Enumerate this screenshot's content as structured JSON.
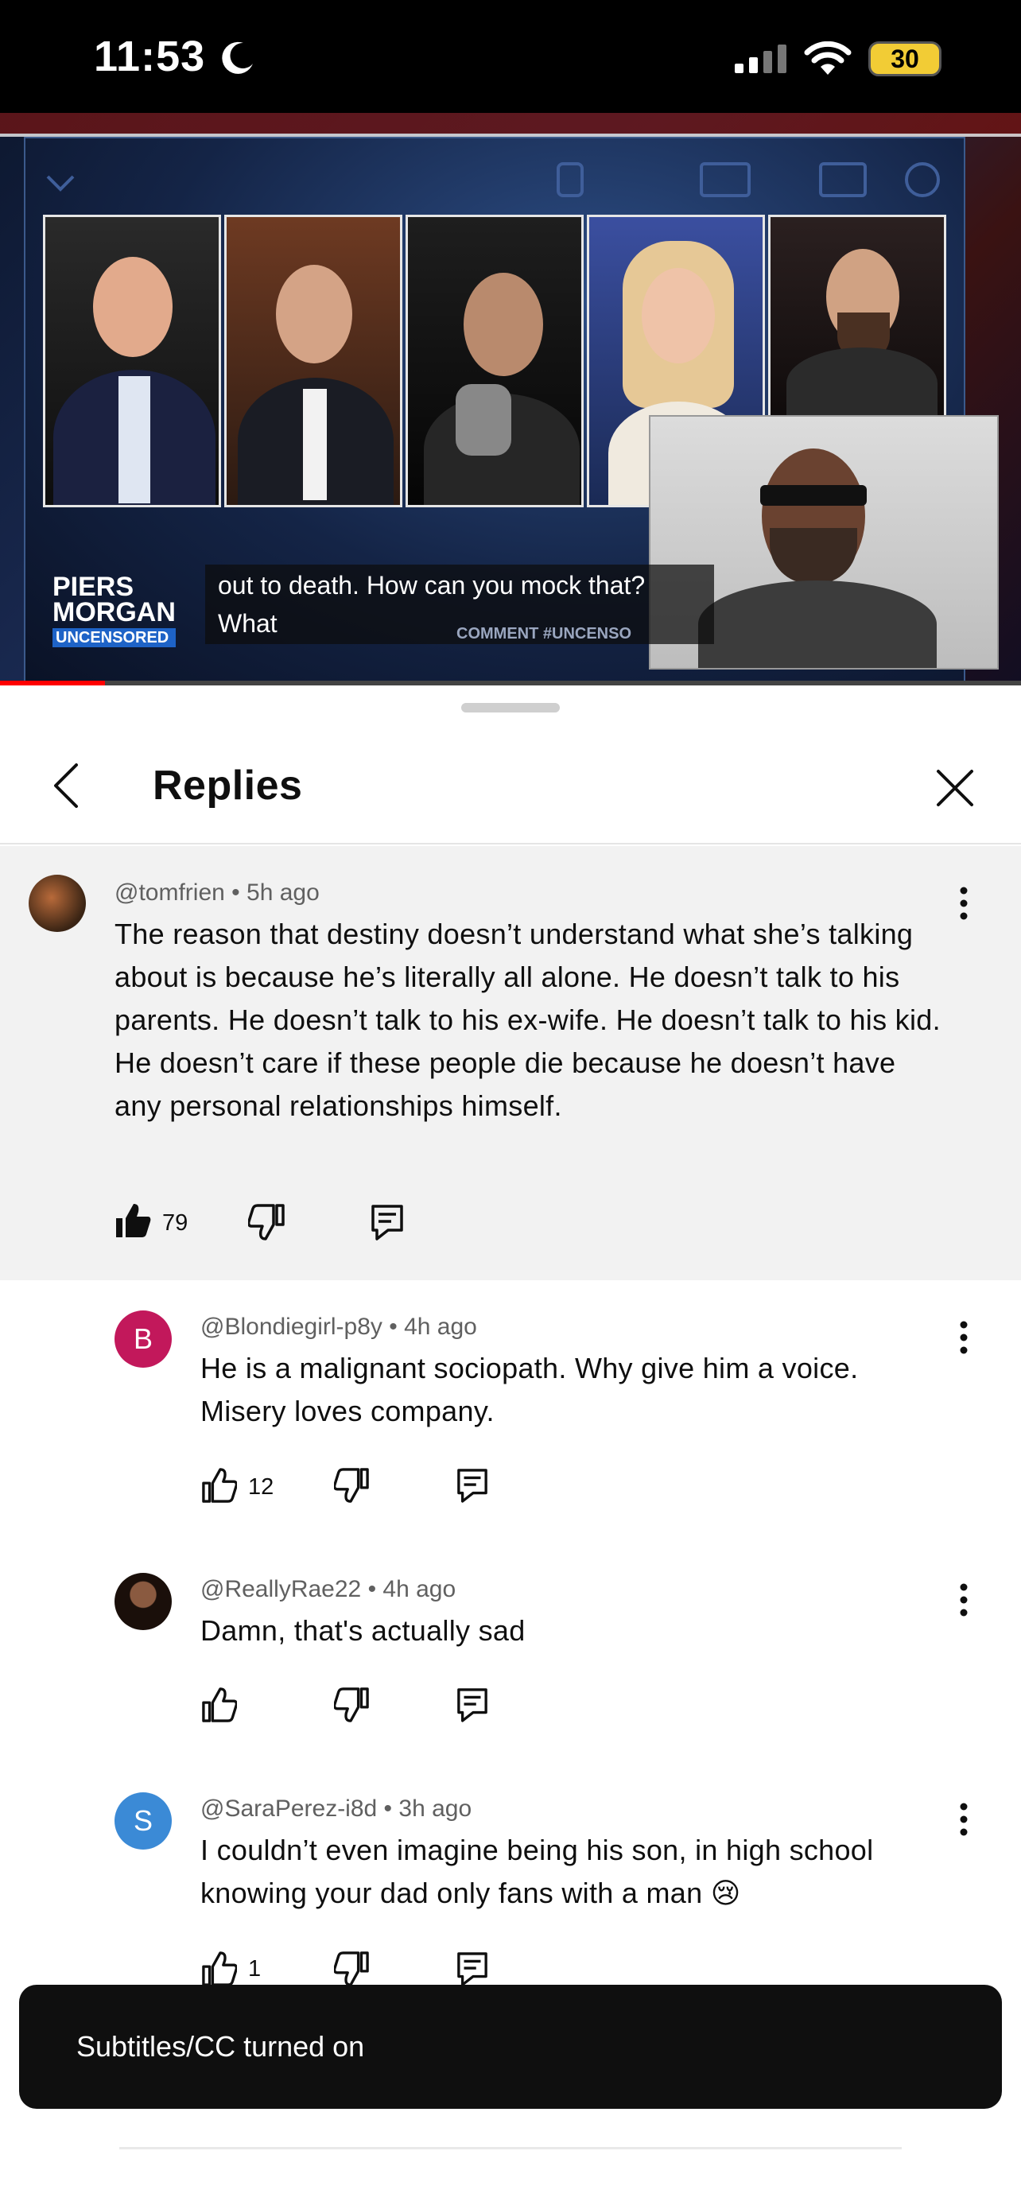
{
  "status_bar": {
    "time": "11:53",
    "battery": "30"
  },
  "video": {
    "show_logo_line1": "PIERS",
    "show_logo_line2": "MORGAN",
    "show_logo_sub": "UNCENSORED",
    "caption_line1": "out to death. How can you mock that?",
    "caption_line2": "What",
    "ticker": "COMMENT #UNCENSO"
  },
  "header": {
    "title": "Replies"
  },
  "top_comment": {
    "author": "@tomfrien",
    "time": "5h ago",
    "text": "The reason that destiny doesn’t understand what she’s talking about is because he’s literally all alone. He doesn’t talk to his parents. He doesn’t talk to his ex-wife. He doesn’t talk to his kid. He doesn’t care if these people die because he doesn’t have any personal relationships himself.",
    "likes": "79"
  },
  "replies": [
    {
      "initial": "B",
      "avatar_color": "#c2185b",
      "author": "@Blondiegirl-p8y",
      "time": "4h ago",
      "text": "He is a malignant sociopath. Why give him a voice. Misery loves company.",
      "likes": "12"
    },
    {
      "initial": "",
      "avatar_color": "#2a1a14",
      "author": "@ReallyRae22",
      "time": "4h ago",
      "text": "Damn, that's actually sad",
      "likes": ""
    },
    {
      "initial": "S",
      "avatar_color": "#3b8ad6",
      "author": "@SaraPerez-i8d",
      "time": "3h ago",
      "text": "I couldn’t even imagine being his son, in high school knowing your dad only fans with a man 😢",
      "likes": "1"
    }
  ],
  "toast": {
    "message": "Subtitles/CC turned on"
  },
  "colors": {
    "accent_red": "#ff0000",
    "toast_bg": "#0f0f0f",
    "highlight_bg": "#f2f2f2"
  }
}
